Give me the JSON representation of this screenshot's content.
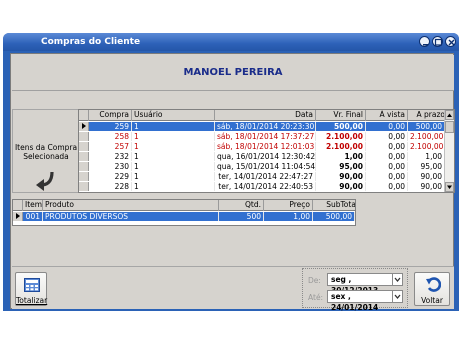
{
  "window": {
    "title": "Compras do Cliente"
  },
  "client_name": "MANOEL PEREIRA",
  "side_panel": {
    "label_line1": "Itens da Compra",
    "label_line2": "Selecionada"
  },
  "purchases": {
    "columns": [
      "Compra",
      "Usuário",
      "Data",
      "Vr. Final",
      "À vista",
      "A prazo"
    ],
    "rows": [
      {
        "compra": "259",
        "usuario": "1",
        "data": "sáb, 18/01/2014 20:23:30",
        "vr_final": "500,00",
        "a_vista": "0,00",
        "a_prazo": "500,00",
        "status": "selected"
      },
      {
        "compra": "258",
        "usuario": "1",
        "data": "sáb, 18/01/2014 17:37:27",
        "vr_final": "2.100,00",
        "a_vista": "0,00",
        "a_prazo": "2.100,00",
        "status": "red"
      },
      {
        "compra": "257",
        "usuario": "1",
        "data": "sáb, 18/01/2014 12:01:03",
        "vr_final": "2.100,00",
        "a_vista": "0,00",
        "a_prazo": "2.100,00",
        "status": "red"
      },
      {
        "compra": "232",
        "usuario": "1",
        "data": "qua, 16/01/2014 12:30:42",
        "vr_final": "1,00",
        "a_vista": "0,00",
        "a_prazo": "1,00",
        "status": "normal"
      },
      {
        "compra": "230",
        "usuario": "1",
        "data": "qua, 15/01/2014 11:04:54",
        "vr_final": "95,00",
        "a_vista": "0,00",
        "a_prazo": "95,00",
        "status": "normal"
      },
      {
        "compra": "229",
        "usuario": "1",
        "data": "ter, 14/01/2014 22:47:27",
        "vr_final": "90,00",
        "a_vista": "0,00",
        "a_prazo": "90,00",
        "status": "normal"
      },
      {
        "compra": "228",
        "usuario": "1",
        "data": "ter, 14/01/2014 22:40:53",
        "vr_final": "90,00",
        "a_vista": "0,00",
        "a_prazo": "90,00",
        "status": "normal"
      }
    ]
  },
  "items": {
    "columns": [
      "Item",
      "Produto",
      "Qtd.",
      "Preço",
      "SubTotal"
    ],
    "rows": [
      {
        "item": "001",
        "produto": "PRODUTOS DIVERSOS",
        "qtd": "500",
        "preco": "1,00",
        "subtotal": "500,00"
      }
    ]
  },
  "footer": {
    "totalizar_label": "Totalizar",
    "de_label": "De:",
    "ate_label": "Até:",
    "de_value": "seg , 30/12/2013",
    "ate_value": "sex , 24/01/2014",
    "voltar_label": "Voltar"
  },
  "colors": {
    "selection": "#3270d0",
    "red_text": "#c00000",
    "title_blue": "#1a2c8a"
  }
}
